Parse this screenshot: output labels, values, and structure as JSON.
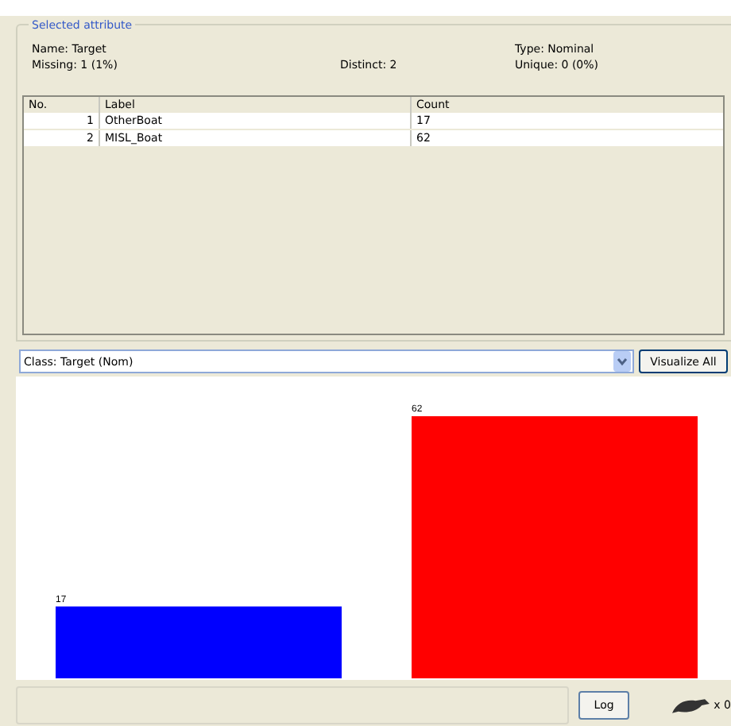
{
  "panel": {
    "title": "Selected attribute",
    "info": {
      "name": "Name: Target",
      "missing": "Missing: 1 (1%)",
      "distinct": "Distinct: 2",
      "type": "Type: Nominal",
      "unique": "Unique: 0 (0%)"
    }
  },
  "table": {
    "columns": [
      "No.",
      "Label",
      "Count"
    ],
    "rows": [
      [
        "1",
        "OtherBoat",
        "17"
      ],
      [
        "2",
        "MISL_Boat",
        "62"
      ]
    ]
  },
  "class_select": {
    "value": "Class: Target (Nom)"
  },
  "visualize_button": "Visualize All",
  "chart": {
    "chart_data": {
      "type": "bar",
      "data_labels": true,
      "categories": [
        null,
        null
      ],
      "values": [
        17,
        62
      ],
      "colors": [
        "#0000ff",
        "#ff0000"
      ]
    }
  },
  "status_bar": {
    "log_button": "Log",
    "count": "x 0"
  }
}
